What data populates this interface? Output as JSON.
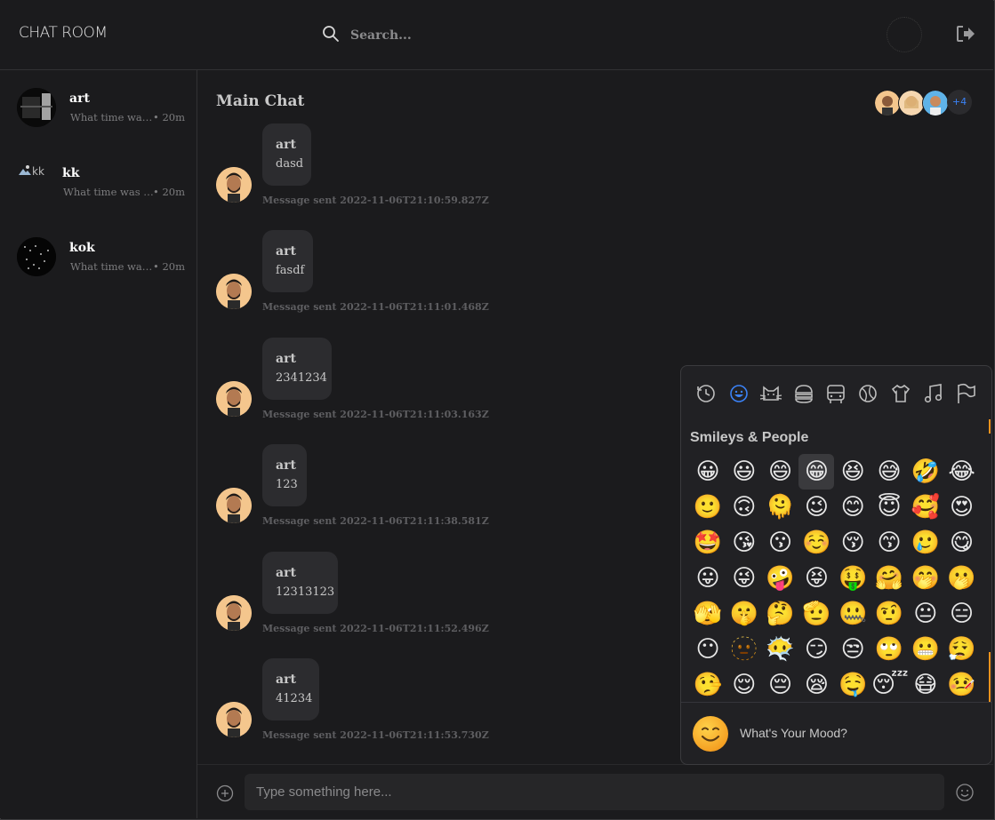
{
  "header": {
    "brand": "CHAT ROOM",
    "search_placeholder": "Search..."
  },
  "sidebar": {
    "conversations": [
      {
        "name": "art",
        "preview": "What time was the meeting again?",
        "time": "• 20m"
      },
      {
        "name": "kk",
        "preview": "What time was the meeting again?",
        "time": "• 20m",
        "broken_image_alt": "kk"
      },
      {
        "name": "kok",
        "preview": "What time was the meeting again?",
        "time": "• 20m"
      }
    ]
  },
  "chat": {
    "title": "Main Chat",
    "members_more": "+4",
    "messages": [
      {
        "author": "art",
        "text": "dasd",
        "meta": "Message sent 2022-11-06T21:10:59.827Z"
      },
      {
        "author": "art",
        "text": "fasdf",
        "meta": "Message sent 2022-11-06T21:11:01.468Z"
      },
      {
        "author": "art",
        "text": "2341234",
        "meta": "Message sent 2022-11-06T21:11:03.163Z"
      },
      {
        "author": "art",
        "text": "123",
        "meta": "Message sent 2022-11-06T21:11:38.581Z"
      },
      {
        "author": "art",
        "text": "12313123",
        "meta": "Message sent 2022-11-06T21:11:52.496Z"
      },
      {
        "author": "art",
        "text": "41234",
        "meta": "Message sent 2022-11-06T21:11:53.730Z"
      }
    ]
  },
  "composer": {
    "placeholder": "Type something here..."
  },
  "emoji_picker": {
    "categories": [
      "recent-icon",
      "smileys-icon",
      "animals-icon",
      "food-icon",
      "travel-icon",
      "activity-icon",
      "objects-icon",
      "symbols-icon",
      "flags-icon"
    ],
    "section_title": "Smileys & People",
    "emojis": [
      "😀",
      "😃",
      "😄",
      "😁",
      "😆",
      "😅",
      "🤣",
      "😂",
      "🙂",
      "🙃",
      "🫠",
      "😉",
      "😊",
      "😇",
      "🥰",
      "😍",
      "🤩",
      "😘",
      "😗",
      "☺️",
      "😚",
      "😙",
      "🥲",
      "😋",
      "😛",
      "😜",
      "🤪",
      "😝",
      "🤑",
      "🤗",
      "🤭",
      "🫢",
      "🫣",
      "🤫",
      "🤔",
      "🫡",
      "🤐",
      "🤨",
      "😐",
      "😑",
      "😶",
      "🫥",
      "😶‍🌫️",
      "😏",
      "😒",
      "🙄",
      "😬",
      "😮‍💨",
      "🤥",
      "😌",
      "😔",
      "😪",
      "🤤",
      "😴",
      "😷",
      "🤒"
    ],
    "hovered_index": 3,
    "footer_text": "What's Your Mood?"
  },
  "colors": {
    "accent": "#3b82f6",
    "scroll_accent": "#f7941d"
  }
}
